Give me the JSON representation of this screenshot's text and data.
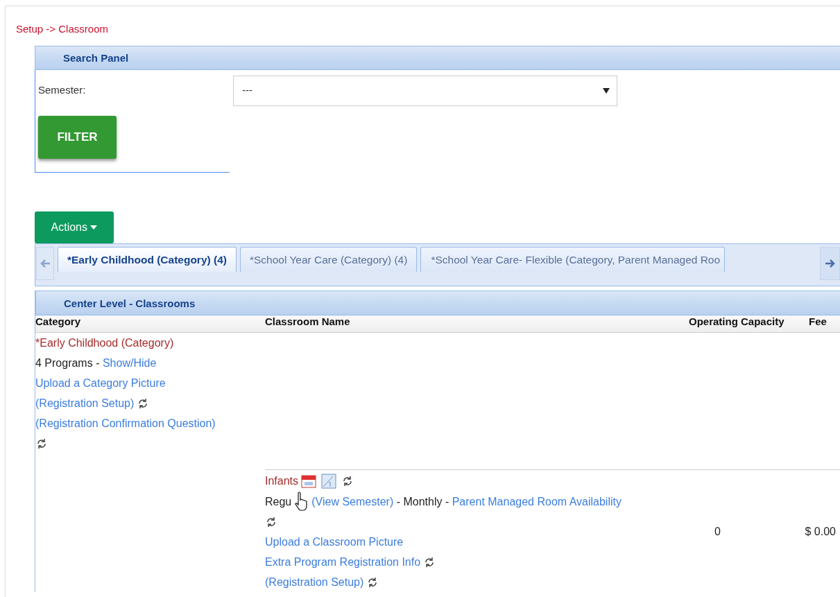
{
  "breadcrumb": "Setup -> Classroom",
  "search_panel": {
    "title": "Search Panel",
    "fields": [
      {
        "label": "Semester:",
        "value": "---"
      }
    ],
    "filter_button": "FILTER"
  },
  "actions_button": "Actions",
  "tabs": [
    {
      "label": "*Early Childhood (Category) (4)",
      "selected": true
    },
    {
      "label": "*School Year Care (Category) (4)",
      "selected": false
    },
    {
      "label": "*School Year Care- Flexible (Category, Parent Managed Roo",
      "selected": false
    }
  ],
  "classrooms_panel": {
    "title": "Center Level - Classrooms",
    "columns": [
      {
        "label": "Category",
        "kind": "text"
      },
      {
        "label": "Classroom Name",
        "kind": "text"
      },
      {
        "label": "Operating Capacity",
        "kind": "number"
      },
      {
        "label": "Fee",
        "kind": "money"
      }
    ],
    "category_lines": [
      [
        {
          "kind": "title",
          "text": "*Early Childhood (Category)"
        }
      ],
      [
        {
          "kind": "text",
          "text": "4 Programs - "
        },
        {
          "kind": "link",
          "text": "Show/Hide"
        }
      ],
      [
        {
          "kind": "link",
          "text": "Upload a Category Picture"
        }
      ],
      [
        {
          "kind": "link",
          "text": "(Registration Setup)"
        },
        {
          "kind": "refresh"
        }
      ],
      [
        {
          "kind": "link",
          "text": "(Registration Confirmation Question)"
        }
      ],
      [
        {
          "kind": "refresh"
        }
      ]
    ],
    "classrooms": [
      {
        "lines": [
          [
            {
              "kind": "title",
              "text": "Infants"
            },
            {
              "kind": "calendar"
            },
            {
              "kind": "schedule"
            },
            {
              "kind": "refresh"
            }
          ],
          [
            {
              "kind": "text",
              "text": "Regu"
            },
            {
              "kind": "cursor"
            },
            {
              "kind": "link",
              "text": "(View Semester)"
            },
            {
              "kind": "text",
              "text": " - Monthly - "
            },
            {
              "kind": "link",
              "text": "Parent Managed Room Availability"
            }
          ],
          [
            {
              "kind": "refresh"
            }
          ],
          [
            {
              "kind": "link",
              "text": "Upload a Classroom Picture"
            }
          ],
          [
            {
              "kind": "link",
              "text": "Extra Program Registration Info"
            },
            {
              "kind": "refresh"
            }
          ],
          [
            {
              "kind": "link",
              "text": "(Registration Setup)"
            },
            {
              "kind": "refresh"
            }
          ]
        ],
        "capacity": "0",
        "fee": "$ 0.00"
      }
    ]
  }
}
